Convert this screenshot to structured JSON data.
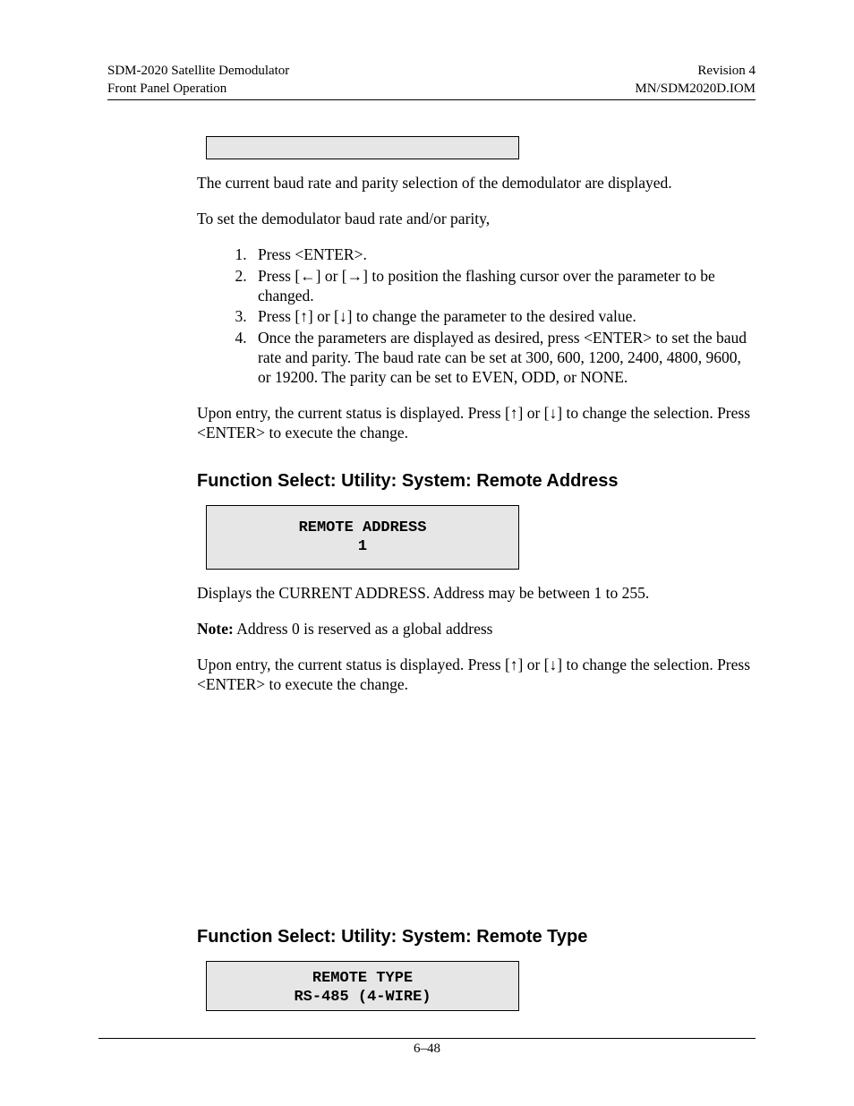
{
  "header": {
    "left1": "SDM-2020 Satellite Demodulator",
    "left2": "Front Panel Operation",
    "right1": "Revision 4",
    "right2": "MN/SDM2020D.IOM"
  },
  "lcd_empty": "",
  "p1": "The current baud rate and parity selection of the demodulator are displayed.",
  "p2": "To set the demodulator baud rate and/or parity,",
  "steps": {
    "s1": "Press <ENTER>.",
    "s2": "Press [←] or [→] to position the flashing cursor over the parameter to be changed.",
    "s3": "Press [↑] or [↓] to change the parameter to the desired value.",
    "s4": "Once the parameters are displayed as desired, press <ENTER> to set the baud rate and parity. The baud rate can be set at 300, 600, 1200, 2400, 4800, 9600,  or 19200. The parity can be set to EVEN, ODD, or NONE."
  },
  "p3": "Upon entry, the current status is displayed. Press [↑] or [↓] to change the selection. Press <ENTER> to execute the change.",
  "heading_addr": "Function Select: Utility: System: Remote Address",
  "lcd_addr_l1": "REMOTE ADDRESS",
  "lcd_addr_l2": "1",
  "p4": "Displays the CURRENT ADDRESS. Address may be between 1 to 255.",
  "note_label": "Note:",
  "note_text": " Address 0 is reserved as a global address",
  "p5": "Upon entry, the current status is displayed. Press [↑] or [↓] to change the selection. Press <ENTER> to execute the change.",
  "heading_type": "Function Select: Utility: System: Remote Type",
  "lcd_type_l1": "REMOTE TYPE",
  "lcd_type_l2": "RS-485  (4-WIRE)",
  "page_num": "6–48"
}
